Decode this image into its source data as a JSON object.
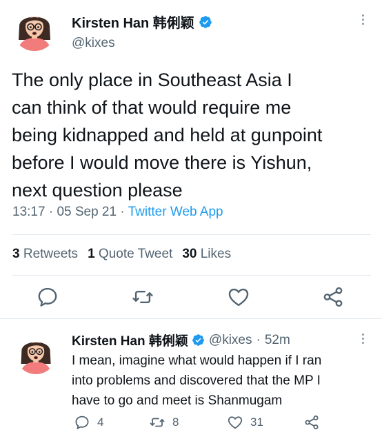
{
  "main_tweet": {
    "author": {
      "display_name": "Kirsten Han 韩俐颖",
      "handle": "@kixes",
      "verified": true,
      "avatar": "avatar-illustration"
    },
    "text_lines": [
      "The only place in Southeast Asia I",
      "can think of that would require me",
      "being kidnapped and held at gunpoint",
      "before I would move there is Yishun,",
      "next question please"
    ],
    "time": "13:17",
    "date": "05 Sep 21",
    "separator": "·",
    "source": "Twitter Web App",
    "stats": {
      "retweets_count": "3",
      "retweets_label": "Retweets",
      "quotes_count": "1",
      "quotes_label": "Quote Tweet",
      "likes_count": "30",
      "likes_label": "Likes"
    },
    "actions": [
      "reply-icon",
      "retweet-icon",
      "like-icon",
      "share-icon"
    ]
  },
  "reply_tweet": {
    "author": {
      "display_name": "Kirsten Han 韩俐颖",
      "handle": "@kixes",
      "verified": true,
      "avatar": "avatar-illustration"
    },
    "time_ago": "52m",
    "separator": "·",
    "text_lines": [
      "I mean, imagine what would happen if I ran",
      "into problems and discovered that the MP I",
      "have to go and meet is Shanmugam"
    ],
    "counts": {
      "replies": "4",
      "retweets": "8",
      "likes": "31"
    }
  },
  "colors": {
    "text": "#0f1419",
    "secondary": "#536471",
    "accent": "#1d9bf0",
    "divider": "#e1e8ed"
  }
}
